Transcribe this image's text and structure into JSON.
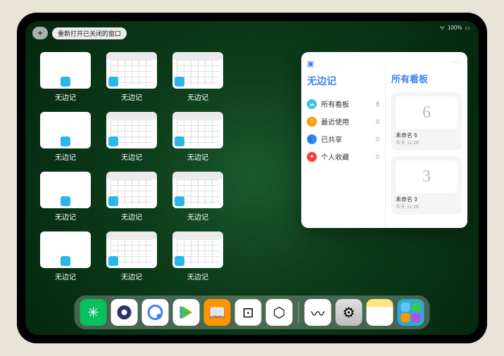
{
  "statusbar": {
    "wifi": "⋮⋮",
    "battery": "100%"
  },
  "topbar": {
    "plus_label": "+",
    "reopen_label": "重新打开已关闭的窗口"
  },
  "app_name": "无边记",
  "windows": [
    {
      "type": "blank",
      "label": "无边记"
    },
    {
      "type": "cal",
      "label": "无边记"
    },
    {
      "type": "cal",
      "label": "无边记"
    },
    {
      "type": "blank",
      "label": "无边记"
    },
    {
      "type": "cal",
      "label": "无边记"
    },
    {
      "type": "cal",
      "label": "无边记"
    },
    {
      "type": "blank",
      "label": "无边记"
    },
    {
      "type": "cal",
      "label": "无边记"
    },
    {
      "type": "cal",
      "label": "无边记"
    },
    {
      "type": "blank",
      "label": "无边记"
    },
    {
      "type": "cal",
      "label": "无边记"
    },
    {
      "type": "cal",
      "label": "无边记"
    }
  ],
  "panel": {
    "left_title": "无边记",
    "right_title": "所有看板",
    "more": "···",
    "items": [
      {
        "icon": "cloud",
        "label": "所有看板",
        "count": "8"
      },
      {
        "icon": "clock",
        "label": "最近使用",
        "count": "0"
      },
      {
        "icon": "share",
        "label": "已共享",
        "count": "0"
      },
      {
        "icon": "heart",
        "label": "个人收藏",
        "count": "0"
      }
    ],
    "boards": [
      {
        "glyph": "6",
        "name": "未命名 6",
        "time": "今天 11:28"
      },
      {
        "glyph": "3",
        "name": "未命名 3",
        "time": "今天 11:26"
      }
    ]
  },
  "dock": [
    {
      "id": "wechat",
      "glyph": "✳",
      "class": "di-wechat"
    },
    {
      "id": "quark",
      "glyph": "",
      "class": "di-quark"
    },
    {
      "id": "qbrowser",
      "glyph": "",
      "class": "di-q2"
    },
    {
      "id": "play",
      "glyph": "",
      "class": "di-play"
    },
    {
      "id": "books",
      "glyph": "📖",
      "class": "di-books"
    },
    {
      "id": "dice",
      "glyph": "⊡",
      "class": "di-dice"
    },
    {
      "id": "hex",
      "glyph": "⬡",
      "class": "di-hex"
    },
    {
      "id": "sep"
    },
    {
      "id": "freeform",
      "glyph": "〰",
      "class": "di-freeform"
    },
    {
      "id": "settings",
      "glyph": "⚙",
      "class": "di-settings"
    },
    {
      "id": "notes",
      "glyph": "",
      "class": "di-notes"
    },
    {
      "id": "applib",
      "glyph": "",
      "class": "di-library"
    }
  ]
}
